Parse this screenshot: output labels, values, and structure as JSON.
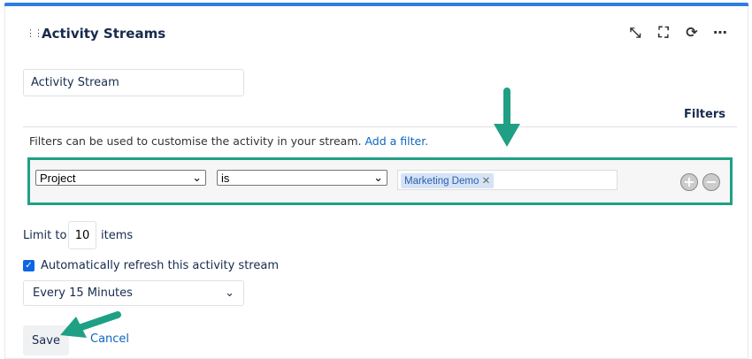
{
  "header": {
    "title": "Activity Streams",
    "icons": [
      "drag-handle-icon",
      "minimize-icon",
      "fullscreen-icon",
      "refresh-icon",
      "more-icon"
    ]
  },
  "form": {
    "title_value": "Activity Stream",
    "filters_heading": "Filters",
    "filters_description": "Filters can be used to customise the activity in your stream.",
    "add_filter_link": "Add a filter.",
    "filter_row": {
      "field": "Project",
      "operator": "is",
      "tag": "Marketing Demo"
    },
    "limit_prefix": "Limit to",
    "limit_value": "10",
    "limit_suffix": "items",
    "auto_refresh_label": "Automatically refresh this activity stream",
    "auto_refresh_checked": true,
    "refresh_interval": "Every 15 Minutes",
    "save_label": "Save",
    "cancel_label": "Cancel"
  },
  "colors": {
    "accent": "#2f7de1",
    "annotation": "#1fa085",
    "link": "#0b66c3"
  }
}
